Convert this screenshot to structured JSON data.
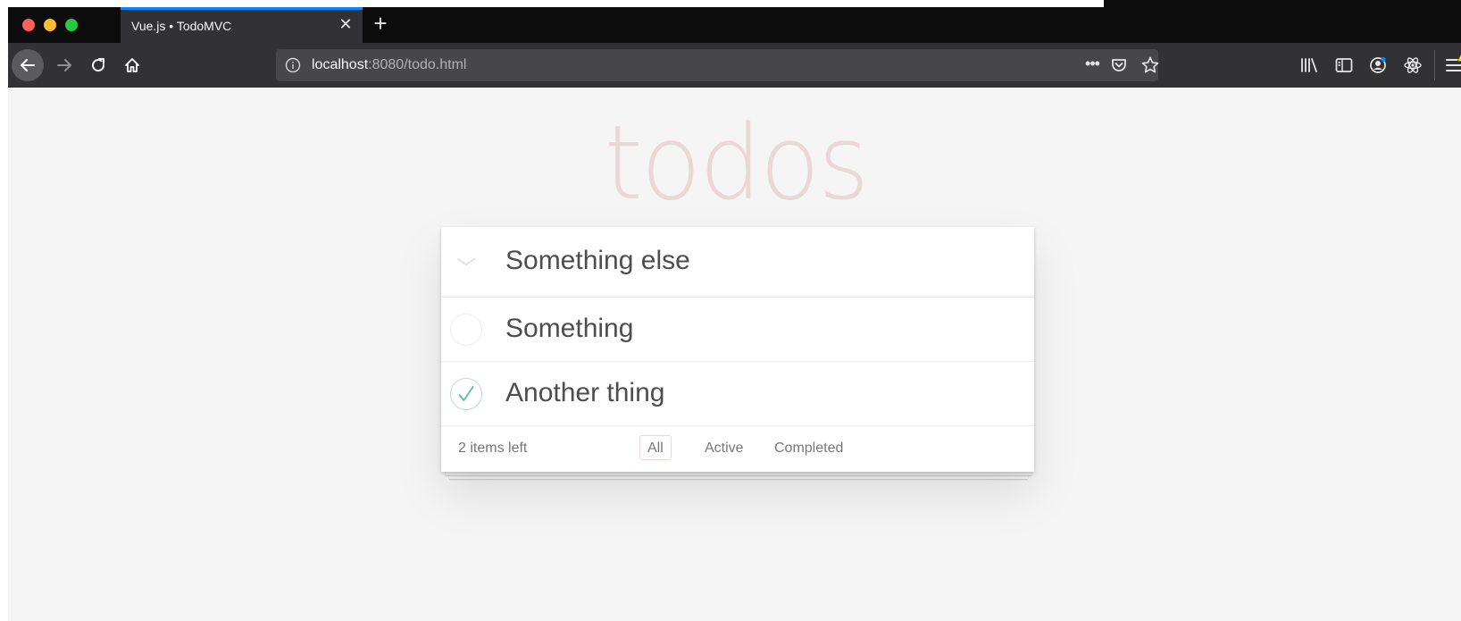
{
  "browser": {
    "tab": {
      "title": "Vue.js • TodoMVC",
      "close_glyph": "✕"
    },
    "new_tab_glyph": "+",
    "url": {
      "host": "localhost",
      "rest": ":8080/todo.html"
    },
    "more_glyph": "•••",
    "colors": {
      "tab_accent": "#0a84ff",
      "toolbar": "#323234",
      "tabstrip": "#0c0c0d"
    },
    "icons": [
      "back-icon",
      "forward-icon",
      "reload-icon",
      "home-icon",
      "site-info-icon",
      "page-actions-icon",
      "pocket-icon",
      "bookmark-star-icon",
      "library-icon",
      "sidebar-icon",
      "account-icon",
      "react-devtools-icon",
      "menu-icon",
      "warning-icon"
    ]
  },
  "app": {
    "title": "todos",
    "new_todo_value": "Something else",
    "todos": [
      {
        "label": "Something",
        "completed": false
      },
      {
        "label": "Another thing",
        "completed": true
      }
    ],
    "footer": {
      "count": "2 items left",
      "filters": [
        {
          "label": "All",
          "selected": true
        },
        {
          "label": "Active",
          "selected": false
        },
        {
          "label": "Completed",
          "selected": false
        }
      ]
    },
    "colors": {
      "title": "#af2f2f",
      "check": "#5dc2af",
      "background": "#f5f5f5"
    }
  }
}
